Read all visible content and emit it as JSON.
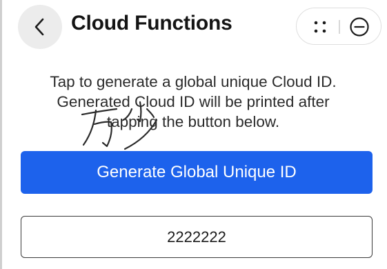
{
  "header": {
    "back_icon": "chevron-left-icon",
    "title": "Cloud Functions",
    "capsule": {
      "more_icon": "more-dots-icon",
      "close_icon": "minus-circle-icon"
    }
  },
  "main": {
    "description_lines": [
      "Tap to generate a global unique Cloud ID.",
      "Generated Cloud ID will be printed after",
      "tapping the button below."
    ],
    "generate_button_label": "Generate Global Unique ID",
    "result_value": "2222222",
    "watermark_text": "万少"
  },
  "colors": {
    "accent": "#1d62ec",
    "back_button_bg": "#ececec",
    "text_primary": "#141414",
    "border": "#3a3a3a"
  }
}
